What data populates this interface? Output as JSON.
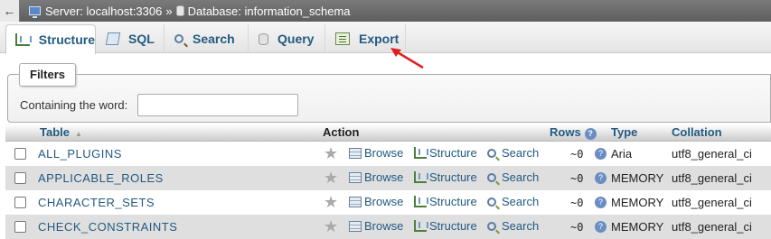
{
  "breadcrumb": {
    "back_label": "←",
    "server": "Server: localhost:3306",
    "separator": "»",
    "database": "Database: information_schema"
  },
  "tabs": [
    {
      "label": "Structure",
      "icon": "structure-icon",
      "active": true
    },
    {
      "label": "SQL",
      "icon": "sql-icon",
      "active": false
    },
    {
      "label": "Search",
      "icon": "search-icon",
      "active": false
    },
    {
      "label": "Query",
      "icon": "query-icon",
      "active": false
    },
    {
      "label": "Export",
      "icon": "export-icon",
      "active": false
    }
  ],
  "annotation": {
    "color": "#e02020",
    "target": "Export"
  },
  "filters": {
    "legend": "Filters",
    "label": "Containing the word:",
    "value": "",
    "placeholder": ""
  },
  "table": {
    "headers": {
      "table": "Table",
      "action": "Action",
      "rows": "Rows",
      "type": "Type",
      "collation": "Collation",
      "help_glyph": "?"
    },
    "actions": {
      "browse": "Browse",
      "structure": "Structure",
      "search": "Search"
    },
    "rows": [
      {
        "name": "ALL_PLUGINS",
        "rows": "~0",
        "type": "Aria",
        "collation": "utf8_general_ci"
      },
      {
        "name": "APPLICABLE_ROLES",
        "rows": "~0",
        "type": "MEMORY",
        "collation": "utf8_general_ci"
      },
      {
        "name": "CHARACTER_SETS",
        "rows": "~0",
        "type": "MEMORY",
        "collation": "utf8_general_ci"
      },
      {
        "name": "CHECK_CONSTRAINTS",
        "rows": "~0",
        "type": "MEMORY",
        "collation": "utf8_general_ci"
      }
    ]
  },
  "colors": {
    "link": "#235a81",
    "even_row": "#dfdfdf",
    "header_bar": "#5e5e5e"
  }
}
